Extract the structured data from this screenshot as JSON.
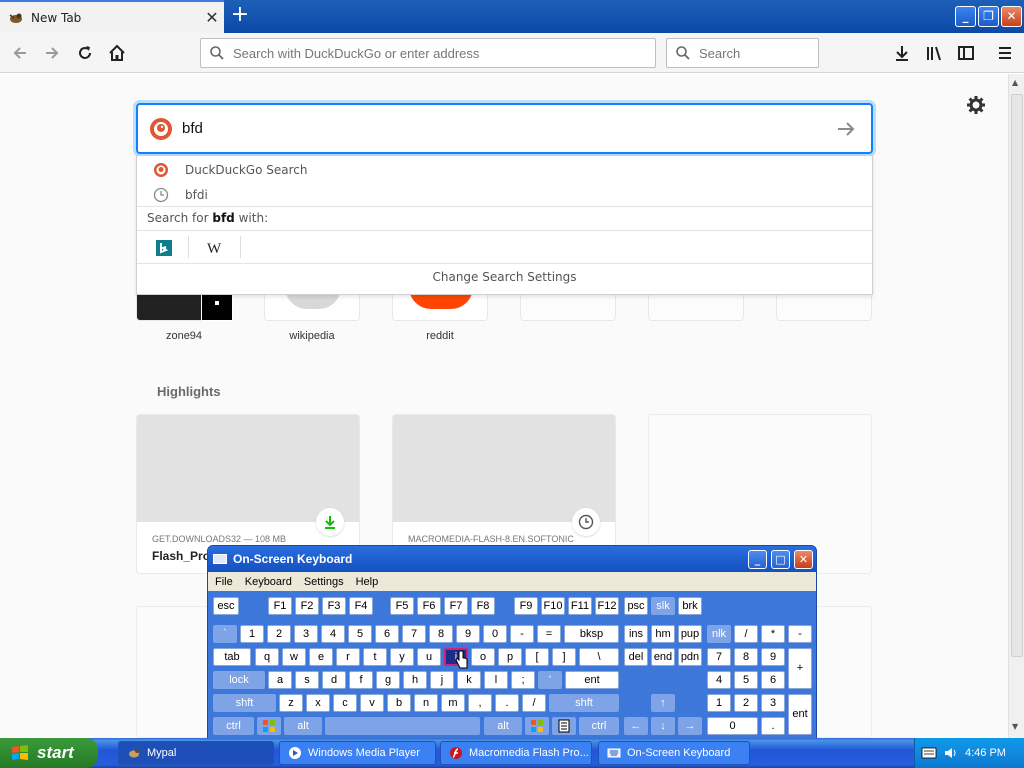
{
  "browser": {
    "tab": {
      "title": "New Tab",
      "close": "✕"
    },
    "new_tab": "+",
    "window_controls": {
      "minimize": "_",
      "restore": "❐",
      "close": "✕"
    },
    "toolbar": {
      "url_placeholder": "Search with DuckDuckGo or enter address",
      "search_placeholder": "Search",
      "icons": [
        "back-icon",
        "forward-icon",
        "reload-icon",
        "home-icon",
        "download-icon",
        "library-icon",
        "sidebar-icon",
        "menu-icon"
      ]
    }
  },
  "newtab": {
    "search": {
      "query": "bfd"
    },
    "dropdown": {
      "items": [
        {
          "label": "DuckDuckGo Search",
          "icon": "duckduckgo-icon"
        },
        {
          "label": "bfdi",
          "icon": "history-icon"
        }
      ],
      "search_for_prefix": "Search for",
      "search_for_term": "bfd",
      "search_for_suffix": "with:",
      "engines": [
        "bing-icon",
        "wikipedia-icon"
      ],
      "change_settings": "Change Search Settings"
    },
    "top_sites": [
      "zone94",
      "wikipedia",
      "reddit"
    ],
    "highlights": {
      "title": "Highlights",
      "cards": [
        {
          "source": "GET.DOWNLOADS32 — 108 MB",
          "title": "Flash_Prof",
          "badge": "download-icon"
        },
        {
          "source": "MACROMEDIA-FLASH-8.EN.SOFTONIC",
          "title": "",
          "badge": "history-icon"
        }
      ]
    }
  },
  "osk": {
    "title": "On-Screen Keyboard",
    "menu": [
      "File",
      "Keyboard",
      "Settings",
      "Help"
    ],
    "controls": {
      "minimize": "_",
      "maximize": "□",
      "close": "✕"
    },
    "keys": {
      "esc": "esc",
      "fkeys1": [
        "F1",
        "F2",
        "F3",
        "F4"
      ],
      "fkeys2": [
        "F5",
        "F6",
        "F7",
        "F8"
      ],
      "fkeys3": [
        "F9",
        "F10",
        "F11",
        "F12"
      ],
      "psc": "psc",
      "slk": "slk",
      "brk": "brk",
      "row1": [
        "`",
        "1",
        "2",
        "3",
        "4",
        "5",
        "6",
        "7",
        "8",
        "9",
        "0",
        "-",
        "="
      ],
      "bksp": "bksp",
      "nav1": [
        "ins",
        "hm",
        "pup"
      ],
      "num1": [
        "nlk",
        "/",
        "*",
        "-"
      ],
      "tab": "tab",
      "row2": [
        "q",
        "w",
        "e",
        "r",
        "t",
        "y",
        "u",
        "i",
        "o",
        "p",
        "[",
        "]",
        "\\"
      ],
      "nav2": [
        "del",
        "end",
        "pdn"
      ],
      "num2": [
        "7",
        "8",
        "9"
      ],
      "numplus": "+",
      "lock": "lock",
      "row3": [
        "a",
        "s",
        "d",
        "f",
        "g",
        "h",
        "j",
        "k",
        "l",
        ";",
        "'"
      ],
      "ent": "ent",
      "num3": [
        "4",
        "5",
        "6"
      ],
      "shft": "shft",
      "row4": [
        "z",
        "x",
        "c",
        "v",
        "b",
        "n",
        "m",
        ",",
        ".",
        "/"
      ],
      "num4": [
        "1",
        "2",
        "3"
      ],
      "nument": "ent",
      "ctrl": "ctrl",
      "alt": "alt",
      "num0": "0",
      "numdot": "."
    }
  },
  "taskbar": {
    "start": "start",
    "tasks": [
      {
        "label": "Mypal",
        "icon": "mypal-icon"
      },
      {
        "label": "Windows Media Player",
        "icon": "media-player-icon"
      },
      {
        "label": "Macromedia Flash Pro...",
        "icon": "flash-icon"
      },
      {
        "label": "On-Screen Keyboard",
        "icon": "keyboard-icon"
      }
    ],
    "clock": "4:46 PM"
  }
}
